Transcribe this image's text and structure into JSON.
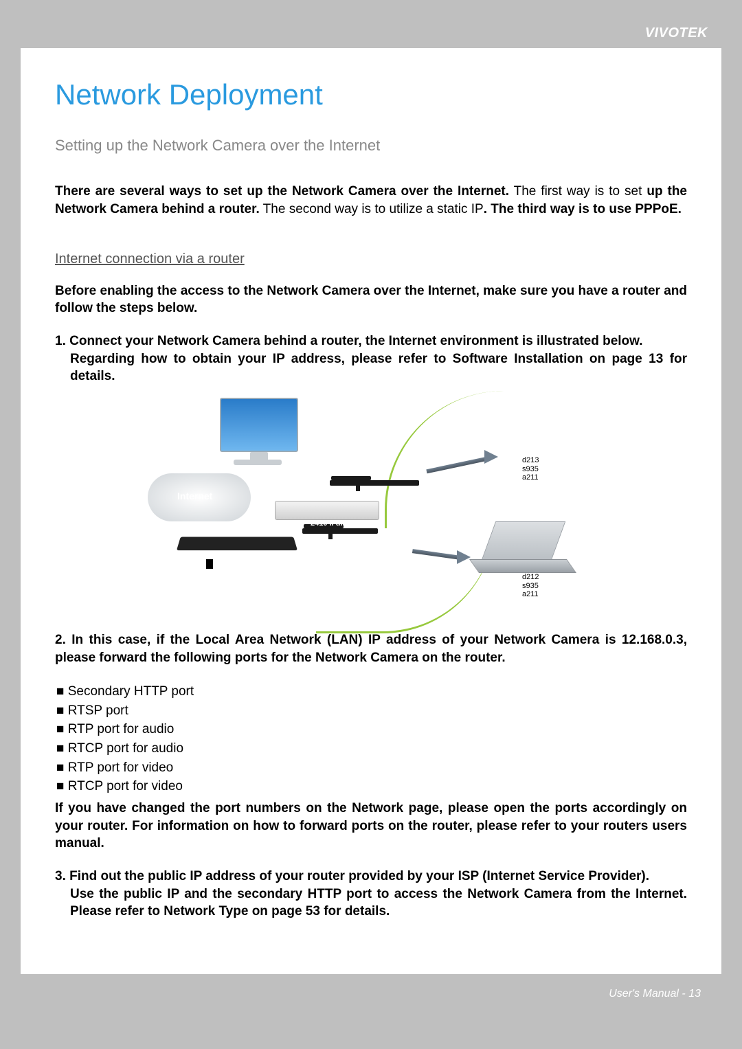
{
  "brand": "VIVOTEK",
  "title": "Network Deployment",
  "subtitle": "Setting up the Network Camera over the Internet",
  "intro": {
    "part1_bold": "There are several ways to set up the Network Camera over the Internet.",
    "part2": " The first way is to set ",
    "part3_bold": "up the Network Camera behind a router.",
    "part4": " The second way is to utilize a static IP",
    "part5_bold": ". The third way is to use PPPoE."
  },
  "section_heading": "Internet connection via a router",
  "before": "Before enabling the access to the Network Camera over the Internet, make sure you have a router and follow the steps below.",
  "step1": {
    "line1": "1. Connect your Network Camera behind a router, the Internet environment is illustrated below.",
    "line2": "Regarding how to obtain your IP address, please refer to Software Installation on page 13 for details."
  },
  "diagram": {
    "cloud_label": "Internet",
    "cam1": {
      "d": "d213",
      "s": "s935",
      "a": "a211"
    },
    "cam2_label": "2410 II dIlnn",
    "laptop": {
      "d": "d212",
      "s": "s935",
      "a": "a211"
    }
  },
  "step2": "2. In this case, if the Local Area Network (LAN) IP address of your Network Camera is 12.168.0.3, please forward the following ports for the Network Camera on the router.",
  "ports": [
    "■ Secondary HTTP port",
    "■ RTSP port",
    "■ RTP port for audio",
    "■ RTCP port for audio",
    "■ RTP port for video",
    "■ RTCP port for video"
  ],
  "port_note": "If you have changed the port numbers on the Network page, please open the ports accordingly on your router. For information on how to forward ports on the router, please refer to your routers users manual.",
  "step3": {
    "line1": "3. Find out the public IP address of your router provided by your ISP (Internet Service Provider).",
    "line2": "Use the public IP and the secondary HTTP port to access the Network Camera from the Internet. Please refer to Network Type on page 53 for details."
  },
  "footer": "User's Manual - 13"
}
